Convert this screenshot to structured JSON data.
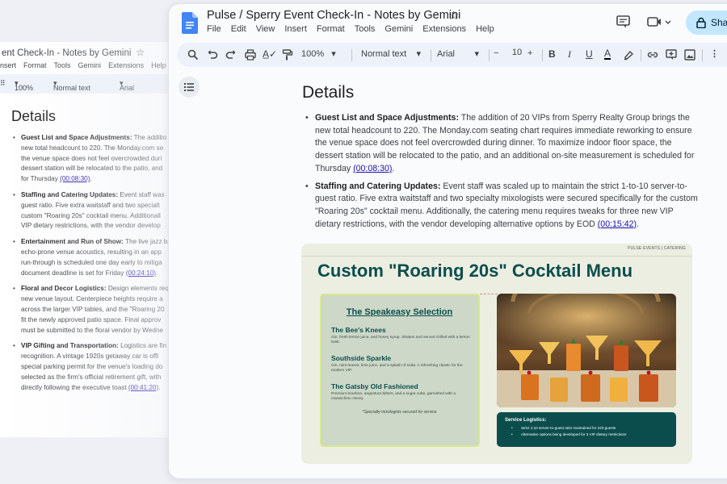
{
  "background_window": {
    "title": "ent Check-In - Notes by Gemini",
    "star_icon": "star-icon",
    "menu": [
      "nsert",
      "Format",
      "Tools",
      "Gemini",
      "Extensions",
      "Help"
    ],
    "zoom": "100%",
    "style": "Normal text",
    "font": "Arial",
    "heading": "Details",
    "items": [
      {
        "title": "Guest List and Space Adjustments:",
        "lines": [
          " The additio",
          "new total headcount to 220. The Monday.com se",
          "the venue space does not feel overcrowded duri",
          "dessert station will be relocated to the patio, and",
          "for Thursday "
        ],
        "timestamp": "(00:08:30)",
        "after": "."
      },
      {
        "title": "Staffing and Catering Updates:",
        "lines": [
          " Event staff was",
          "guest ratio. Five extra waitstaff and two specialt",
          "custom \"Roaring 20s\" cocktail menu. Additionall",
          "VIP dietary restrictions, with the vendor develop"
        ],
        "timestamp": "",
        "after": ""
      },
      {
        "title": "Entertainment and Run of Show:",
        "lines": [
          " The live jazz ba",
          "echo-prone venue acoustics, resulting in an app",
          "run-through is scheduled one day early to mitiga",
          "document deadline is set for Friday "
        ],
        "timestamp": "(00:24:10)",
        "after": "."
      },
      {
        "title": "Floral and Decor Logistics:",
        "lines": [
          " Design elements req",
          "new venue layout. Centerpiece heights require a",
          "across the larger VIP tables, and the \"Roaring 20",
          "fit the newly approved patio space. Final approv",
          "must be submitted to the floral vendor by Wedne"
        ],
        "timestamp": "",
        "after": ""
      },
      {
        "title": "VIP Gifting and Transportation:",
        "lines": [
          " Logistics are fin",
          "recognition. A vintage 1920s getaway car is offi",
          "special parking permit for the venue's loading do",
          "selected as the firm's official retirement gift, with",
          "directly following the executive toast "
        ],
        "timestamp": "(00:41:20)",
        "after": "."
      }
    ]
  },
  "window": {
    "title": "Pulse / Sperry Event Check-In - Notes by Gemini",
    "menu": [
      "File",
      "Edit",
      "View",
      "Insert",
      "Format",
      "Tools",
      "Gemini",
      "Extensions",
      "Help"
    ],
    "share_label": "Shar",
    "icons": {
      "logo": "docs-logo-icon",
      "comment": "comment-icon",
      "meet": "video-call-icon",
      "lock": "lock-icon",
      "star": "star-icon"
    },
    "accent": "#c2e7ff"
  },
  "toolbar": {
    "zoom": "100%",
    "style": "Normal text",
    "font": "Arial",
    "font_size": "10",
    "minus": "−",
    "plus": "+",
    "bold": "B",
    "italic": "I",
    "underline": "U",
    "text_color": "A"
  },
  "document": {
    "heading": "Details",
    "items": [
      {
        "title": "Guest List and Space Adjustments:",
        "text": " The addition of 20 VIPs from Sperry Realty Group brings the new total headcount to 220. The Monday.com seating chart requires immediate reworking to ensure the venue space does not feel overcrowded during dinner. To maximize indoor floor space, the dessert station will be relocated to the patio, and an additional on-site measurement is scheduled for Thursday ",
        "timestamp": "(00:08:30)",
        "after": "."
      },
      {
        "title": "Staffing and Catering Updates:",
        "text": " Event staff was scaled up to maintain the strict 1-to-10 server-to-guest ratio. Five extra waitstaff and two specialty mixologists were secured specifically for the custom \"Roaring 20s\" cocktail menu. Additionally, the catering menu requires tweaks for three new VIP dietary restrictions, with the vendor developing alternative options by EOD ",
        "timestamp": "(00:15:42)",
        "after": "."
      }
    ]
  },
  "slide": {
    "tag": "PULSE EVENTS | CATERING",
    "title": "Custom \"Roaring 20s\" Cocktail Menu",
    "menu_heading": "The Speakeasy Selection",
    "drinks": [
      {
        "name": "The Bee's Knees",
        "desc": "Gin, fresh lemon juice, and honey syrup. Shaken and served chilled with a lemon twist."
      },
      {
        "name": "Southside Sparkle",
        "desc": "Gin, mint leaves, lime juice, and a splash of soda. A refreshing classic for the modern VIP."
      },
      {
        "name": "The Gatsby Old Fashioned",
        "desc": "Premium bourbon, angostura bitters, and a sugar cube, garnished with a maraschino cherry."
      }
    ],
    "note": "*Specialty mixologists secured for service",
    "logistics_title": "Service Logistics:",
    "logistics": [
      "Strict 1:10 server-to-guest ratio maintained for 220 guests",
      "Alternative options being developed for 3 VIP dietary restrictions"
    ],
    "colors": {
      "teal": "#0b4d4d",
      "card": "#cdd8c8",
      "card_border": "#d8e68d",
      "background": "#eceee1"
    }
  }
}
